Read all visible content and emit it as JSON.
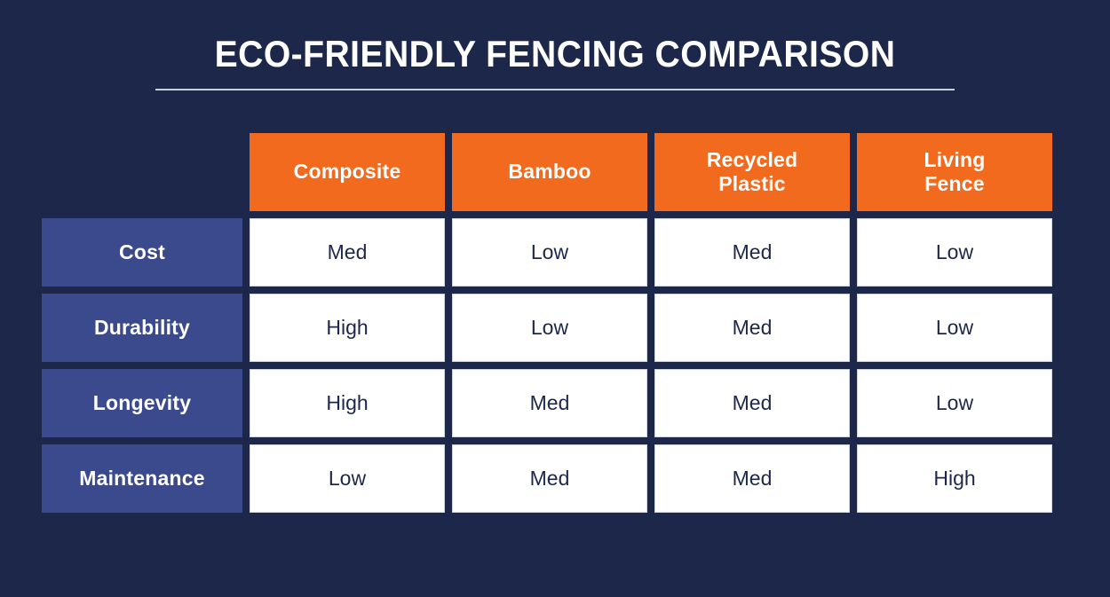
{
  "header": {
    "title": "ECO-FRIENDLY FENCING COMPARISON"
  },
  "colors": {
    "background": "#1c2749",
    "header_orange": "#f26a1d",
    "row_label_blue": "#3a4a8c",
    "cell_white": "#ffffff",
    "cell_text": "#1c2749",
    "rule": "#c9cedd",
    "cell_border": "#cfd4e2"
  },
  "table": {
    "corner_label": "",
    "columns": [
      {
        "label": "Composite"
      },
      {
        "label": "Bamboo"
      },
      {
        "label": "Recycled\nPlastic"
      },
      {
        "label": "Living\nFence"
      }
    ],
    "rows": [
      {
        "label": "Cost",
        "cells": [
          "Med",
          "Low",
          "Med",
          "Low"
        ]
      },
      {
        "label": "Durability",
        "cells": [
          "High",
          "Low",
          "Med",
          "Low"
        ]
      },
      {
        "label": "Longevity",
        "cells": [
          "High",
          "Med",
          "Med",
          "Low"
        ]
      },
      {
        "label": "Maintenance",
        "cells": [
          "Low",
          "Med",
          "Med",
          "High"
        ]
      }
    ]
  },
  "chart_data": {
    "type": "table",
    "title": "ECO-FRIENDLY FENCING COMPARISON",
    "xlabel": "",
    "ylabel": "",
    "categories": [
      "Composite",
      "Bamboo",
      "Recycled Plastic",
      "Living Fence"
    ],
    "row_categories": [
      "Cost",
      "Durability",
      "Longevity",
      "Maintenance"
    ],
    "series": [
      {
        "name": "Composite",
        "values": [
          "Med",
          "High",
          "High",
          "Low"
        ]
      },
      {
        "name": "Bamboo",
        "values": [
          "Low",
          "Low",
          "Med",
          "Med"
        ]
      },
      {
        "name": "Recycled Plastic",
        "values": [
          "Med",
          "Med",
          "Med",
          "Med"
        ]
      },
      {
        "name": "Living Fence",
        "values": [
          "Low",
          "Low",
          "Low",
          "High"
        ]
      }
    ],
    "scale_levels": [
      "Low",
      "Med",
      "High"
    ],
    "legend_position": "none",
    "grid": false
  }
}
